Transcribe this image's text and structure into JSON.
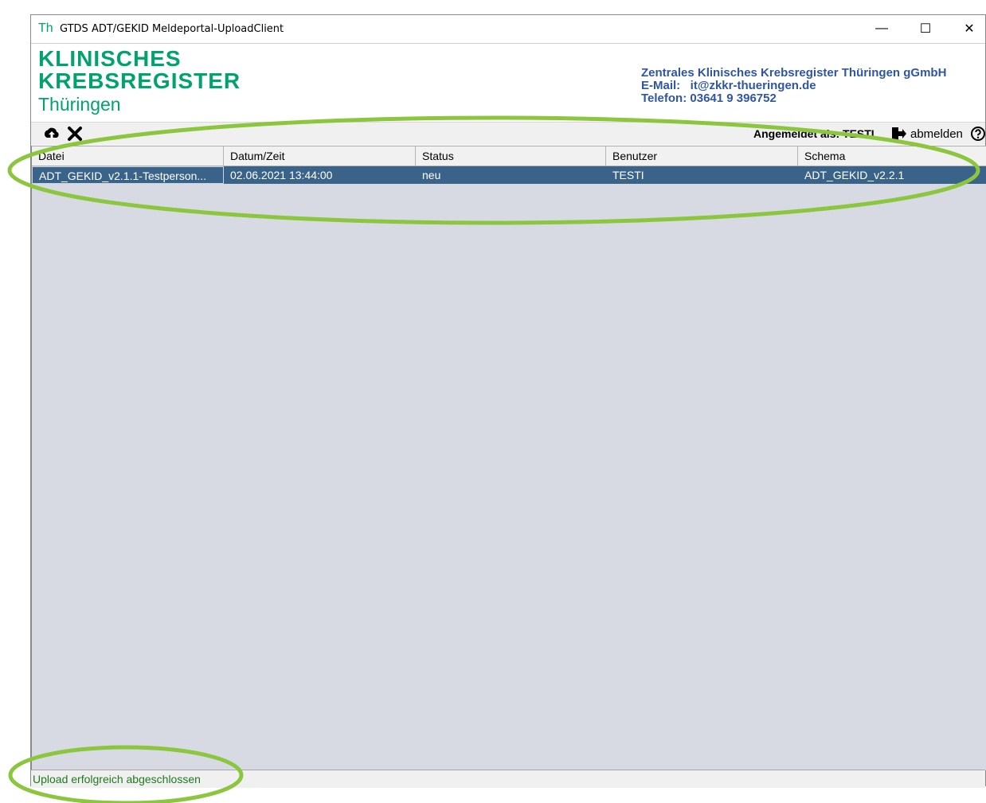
{
  "window": {
    "title_icon": "Th",
    "title": "GTDS ADT/GEKID Meldeportal-UploadClient",
    "controls": {
      "minimize": "—",
      "maximize": "☐",
      "close": "✕"
    }
  },
  "header": {
    "logo": {
      "line1": "KLINISCHES",
      "line2": "KREBSREGISTER",
      "line3": "Thüringen"
    },
    "org_name": "Zentrales Klinisches Krebsregister Thüringen gGmbH",
    "email_line": "E-Mail:   it@zkkr-thueringen.de",
    "phone_line": "Telefon: 03641 9 396752"
  },
  "toolbar": {
    "upload_icon": "cloud-upload-icon",
    "delete_icon": "close-icon",
    "login_label": "Angemeldet als: TESTI",
    "logout_label": "abmelden",
    "help_icon": "help-icon"
  },
  "table": {
    "columns": [
      "Datei",
      "Datum/Zeit",
      "Status",
      "Benutzer",
      "Schema"
    ],
    "rows": [
      [
        "ADT_GEKID_v2.1.1-Testperson...",
        "02.06.2021 13:44:00",
        "neu",
        "TESTI",
        "ADT_GEKID_v2.2.1"
      ]
    ]
  },
  "status_bar": {
    "message": "Upload erfolgreich abgeschlossen"
  },
  "colors": {
    "brand_green": "#00a36e",
    "org_blue": "#2f56a0",
    "selection": "#3a6389",
    "annotation_green": "#8cc63f"
  }
}
